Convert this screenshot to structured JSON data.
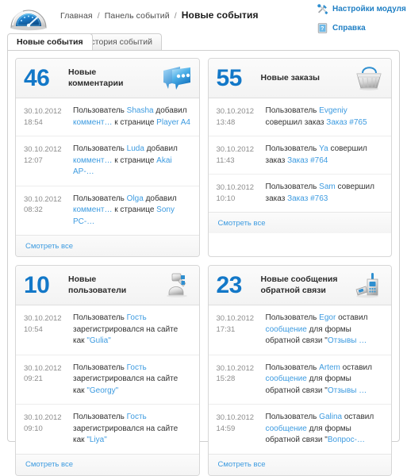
{
  "header": {
    "logo_icon": "gauge-speedometer-icon",
    "breadcrumb": {
      "items": [
        "Главная",
        "Панель событий"
      ],
      "separator": "/",
      "current": "Новые события"
    },
    "actions": [
      {
        "icon": "tools-wrench-screwdriver-icon",
        "label": "Настройки модуля"
      },
      {
        "icon": "help-book-icon",
        "label": "Справка"
      }
    ]
  },
  "tabs": [
    {
      "label": "Новые события",
      "active": true
    },
    {
      "label": "История событий",
      "active": false
    }
  ],
  "colors": {
    "count_blue": "#1378c8",
    "link_blue": "#3d9be0",
    "action_blue": "#1f7fc4",
    "panel_border": "#d7d7d7",
    "frame_border": "#cfcfcf"
  },
  "panels": [
    {
      "count": "46",
      "title": "Новые\nкомментарии",
      "title_line1": "Новые",
      "title_line2": "комментарии",
      "icon": "speech-bubble-icon",
      "footer_label": "Смотреть все",
      "items": [
        {
          "date": "30.10.2012",
          "time": "18:54",
          "parts": [
            {
              "t": "Пользователь ",
              "link": false
            },
            {
              "t": "Shasha",
              "link": true
            },
            {
              "t": " добавил ",
              "link": false
            },
            {
              "t": "коммент…",
              "link": true
            },
            {
              "t": "  к странице ",
              "link": false
            },
            {
              "t": "Player A4",
              "link": true
            }
          ]
        },
        {
          "date": "30.10.2012",
          "time": "12:07",
          "parts": [
            {
              "t": "Пользователь ",
              "link": false
            },
            {
              "t": "Luda",
              "link": true
            },
            {
              "t": " добавил ",
              "link": false
            },
            {
              "t": "коммент…",
              "link": true
            },
            {
              "t": "  к странице ",
              "link": false
            },
            {
              "t": "Akai AP-…",
              "link": true
            }
          ]
        },
        {
          "date": "30.10.2012",
          "time": "08:32",
          "parts": [
            {
              "t": "Пользователь ",
              "link": false
            },
            {
              "t": "Olga",
              "link": true
            },
            {
              "t": " добавил ",
              "link": false
            },
            {
              "t": "коммент…",
              "link": true
            },
            {
              "t": "  к странице ",
              "link": false
            },
            {
              "t": "Sony PC-…",
              "link": true
            }
          ]
        }
      ]
    },
    {
      "count": "55",
      "title": "Новые заказы",
      "title_line1": "Новые заказы",
      "title_line2": "",
      "icon": "shopping-basket-icon",
      "footer_label": "Смотреть все",
      "items": [
        {
          "date": "30.10.2012",
          "time": "13:48",
          "parts": [
            {
              "t": "Пользователь ",
              "link": false
            },
            {
              "t": "Evgeniy",
              "link": true
            },
            {
              "t": " совершил заказ ",
              "link": false
            },
            {
              "t": "Заказ #765",
              "link": true
            }
          ]
        },
        {
          "date": "30.10.2012",
          "time": "11:43",
          "parts": [
            {
              "t": "Пользователь ",
              "link": false
            },
            {
              "t": "Ya",
              "link": true
            },
            {
              "t": " совершил заказ ",
              "link": false
            },
            {
              "t": "Заказ #764",
              "link": true
            }
          ]
        },
        {
          "date": "30.10.2012",
          "time": "10:10",
          "parts": [
            {
              "t": "Пользователь ",
              "link": false
            },
            {
              "t": "Sam",
              "link": true
            },
            {
              "t": " совершил заказ ",
              "link": false
            },
            {
              "t": "Заказ #763",
              "link": true
            }
          ]
        }
      ]
    },
    {
      "count": "10",
      "title": "Новые пользователи",
      "title_line1": "Новые",
      "title_line2": "пользователи",
      "icon": "user-registration-icon",
      "footer_label": "Смотреть все",
      "items": [
        {
          "date": "30.10.2012",
          "time": "10:54",
          "parts": [
            {
              "t": "Пользователь ",
              "link": false
            },
            {
              "t": "Гость",
              "link": true
            },
            {
              "t": " зарегистрировался на сайте как ",
              "link": false
            },
            {
              "t": "\"Gulia\"",
              "link": true
            }
          ]
        },
        {
          "date": "30.10.2012",
          "time": "09:21",
          "parts": [
            {
              "t": "Пользователь ",
              "link": false
            },
            {
              "t": "Гость",
              "link": true
            },
            {
              "t": " зарегистрировался на сайте как ",
              "link": false
            },
            {
              "t": "\"Georgy\"",
              "link": true
            }
          ]
        },
        {
          "date": "30.10.2012",
          "time": "09:10",
          "parts": [
            {
              "t": "Пользователь ",
              "link": false
            },
            {
              "t": "Гость",
              "link": true
            },
            {
              "t": " зарегистрировался на сайте как ",
              "link": false
            },
            {
              "t": "\"Liya\"",
              "link": true
            }
          ]
        }
      ]
    },
    {
      "count": "23",
      "title": "Новые сообщения обратной связи",
      "title_line1": "Новые сообщения",
      "title_line2": "обратной связи",
      "icon": "phone-feedback-icon",
      "footer_label": "Смотреть все",
      "items": [
        {
          "date": "30.10.2012",
          "time": "17:31",
          "parts": [
            {
              "t": "Пользователь ",
              "link": false
            },
            {
              "t": "Egor",
              "link": true
            },
            {
              "t": " оставил ",
              "link": false
            },
            {
              "t": "сообщение",
              "link": true
            },
            {
              "t": " для формы обратной связи \"",
              "link": false
            },
            {
              "t": "Отзывы …",
              "link": true
            }
          ]
        },
        {
          "date": "30.10.2012",
          "time": "15:28",
          "parts": [
            {
              "t": "Пользователь ",
              "link": false
            },
            {
              "t": "Artem",
              "link": true
            },
            {
              "t": " оставил ",
              "link": false
            },
            {
              "t": "сообщение",
              "link": true
            },
            {
              "t": " для формы обратной связи \"",
              "link": false
            },
            {
              "t": "Отзывы …",
              "link": true
            }
          ]
        },
        {
          "date": "30.10.2012",
          "time": "14:59",
          "parts": [
            {
              "t": "Пользователь ",
              "link": false
            },
            {
              "t": "Galina",
              "link": true
            },
            {
              "t": " оставил ",
              "link": false
            },
            {
              "t": "сообщение",
              "link": true
            },
            {
              "t": " для формы обратной связи \"",
              "link": false
            },
            {
              "t": "Вопрос-…",
              "link": true
            }
          ]
        }
      ]
    }
  ]
}
